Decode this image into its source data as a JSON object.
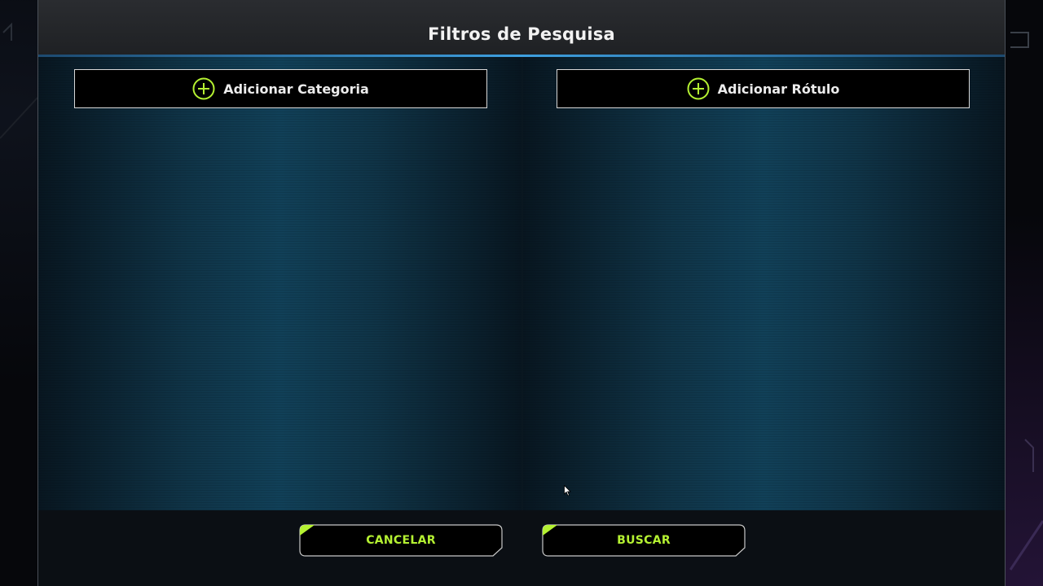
{
  "dialog": {
    "title": "Filtros de Pesquisa"
  },
  "left_panel": {
    "add_button_label": "Adicionar Categoria",
    "add_icon": "plus-circle-icon"
  },
  "right_panel": {
    "add_button_label": "Adicionar Rótulo",
    "add_icon": "plus-circle-icon"
  },
  "footer": {
    "cancel_label": "CANCELAR",
    "search_label": "BUSCAR"
  },
  "colors": {
    "accent_green": "#b5f232",
    "header_line_blue": "#3ea0e0",
    "panel_teal": "#114058"
  }
}
